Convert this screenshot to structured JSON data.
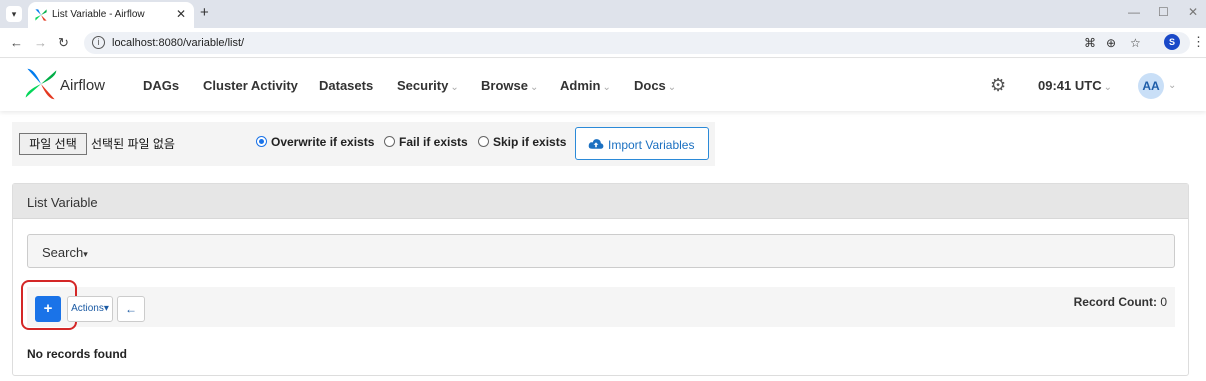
{
  "browser": {
    "tab_title": "List Variable - Airflow",
    "url": "localhost:8080/variable/list/",
    "profile_initial": "S"
  },
  "navbar": {
    "brand": "Airflow",
    "items": [
      {
        "label": "DAGs",
        "dropdown": false
      },
      {
        "label": "Cluster Activity",
        "dropdown": false
      },
      {
        "label": "Datasets",
        "dropdown": false
      },
      {
        "label": "Security",
        "dropdown": true
      },
      {
        "label": "Browse",
        "dropdown": true
      },
      {
        "label": "Admin",
        "dropdown": true
      },
      {
        "label": "Docs",
        "dropdown": true
      }
    ],
    "time": "09:41 UTC",
    "user_initials": "AA"
  },
  "import_form": {
    "file_button": "파일 선택",
    "file_status": "선택된 파일 없음",
    "options": [
      {
        "label": "Overwrite if exists",
        "checked": true
      },
      {
        "label": "Fail if exists",
        "checked": false
      },
      {
        "label": "Skip if exists",
        "checked": false
      }
    ],
    "import_button": "Import Variables"
  },
  "list": {
    "title": "List Variable",
    "search_label": "Search",
    "add_button": "+",
    "actions_button": "Actions",
    "back_button": "←",
    "record_count_label": "Record Count:",
    "record_count": "0",
    "empty_message": "No records found"
  },
  "colors": {
    "primary": "#1a73e8",
    "highlight": "#d42727",
    "logo_green": "#00ad46",
    "logo_red": "#e43921",
    "logo_blue": "#017cee",
    "logo_teal": "#04d659"
  }
}
